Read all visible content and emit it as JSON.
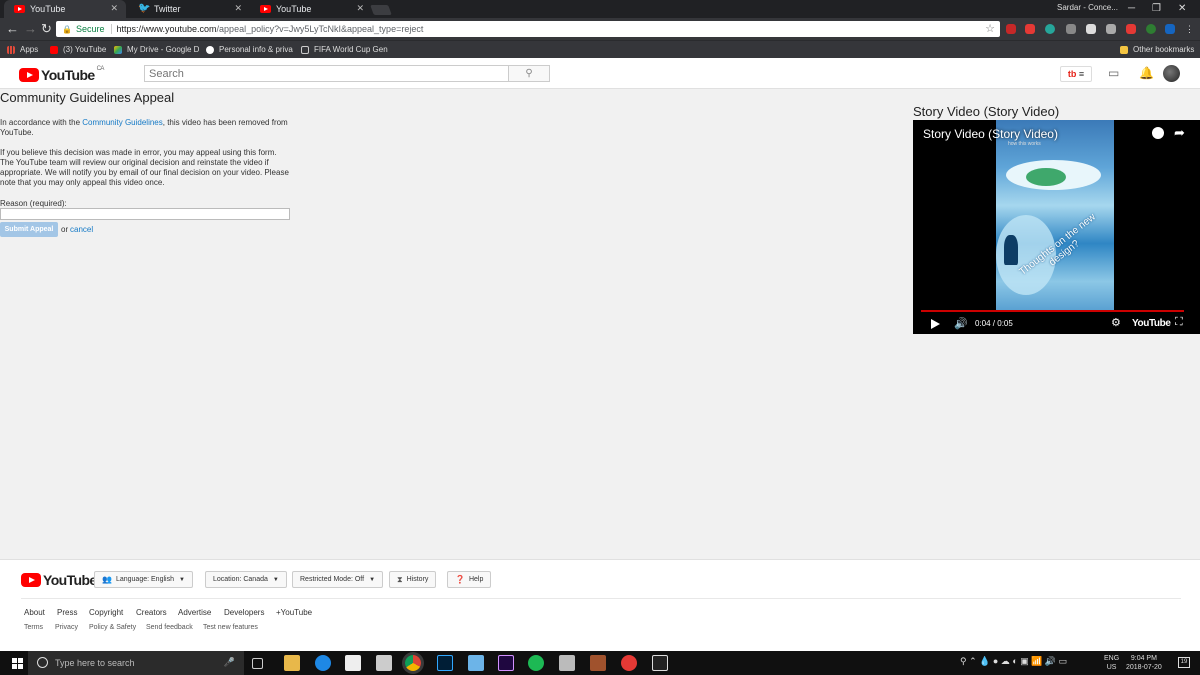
{
  "browser": {
    "tabs": [
      {
        "label": "YouTube",
        "icon": "youtube-icon"
      },
      {
        "label": "Twitter",
        "icon": "twitter-bird-icon"
      },
      {
        "label": "YouTube",
        "icon": "youtube-icon"
      }
    ],
    "user": "Sardar - Conce...",
    "secure_label": "Secure",
    "url_host": "https://www.youtube.com",
    "url_path": "/appeal_policy?v=Jwy5LyTcNkI&appeal_type=reject",
    "bookmarks": [
      {
        "label": "Apps"
      },
      {
        "label": "(3) YouTube"
      },
      {
        "label": "My Drive - Google D"
      },
      {
        "label": "Personal info & priva"
      },
      {
        "label": "FIFA World Cup Gen"
      }
    ],
    "other_bookmarks": "Other bookmarks"
  },
  "header": {
    "logo": "YouTube",
    "region": "CA",
    "search_placeholder": "Search",
    "tb_label": "tb",
    "accent": "#ff0000"
  },
  "appeal": {
    "title": "Community Guidelines Appeal",
    "para1_before": "In accordance with the ",
    "para1_link": "Community Guidelines",
    "para1_after": ", this video has been removed from YouTube.",
    "para2": "If you believe this decision was made in error, you may appeal using this form. The YouTube team will review our original decision and reinstate the video if appropriate. We will notify you by email of our final decision on your video. Please note that you may only appeal this video once.",
    "reason_label": "Reason (required):",
    "submit_label": "Submit Appeal",
    "or_text": "or",
    "cancel_label": "cancel",
    "link_color": "#167ac6"
  },
  "video": {
    "title": "Story Video (Story Video)",
    "player_title": "Story Video (Story Video)",
    "overlay_text": "Thoughts on the new design?",
    "hint_text": "how this works",
    "time_current": "0:04",
    "time_total": "0:05",
    "progress": 0.97,
    "player_logo": "YouTube"
  },
  "footer": {
    "logo": "YouTube",
    "language": "Language: English",
    "location": "Location: Canada",
    "restricted": "Restricted Mode: Off",
    "history": "History",
    "help": "Help",
    "links1": [
      "About",
      "Press",
      "Copyright",
      "Creators",
      "Advertise",
      "Developers",
      "+YouTube"
    ],
    "links2": [
      "Terms",
      "Privacy",
      "Policy & Safety",
      "Send feedback",
      "Test new features"
    ]
  },
  "taskbar": {
    "search_placeholder": "Type here to search",
    "lang1": "ENG",
    "lang2": "US",
    "time": "9:04 PM",
    "date": "2018-07-20",
    "notifications": "19"
  }
}
